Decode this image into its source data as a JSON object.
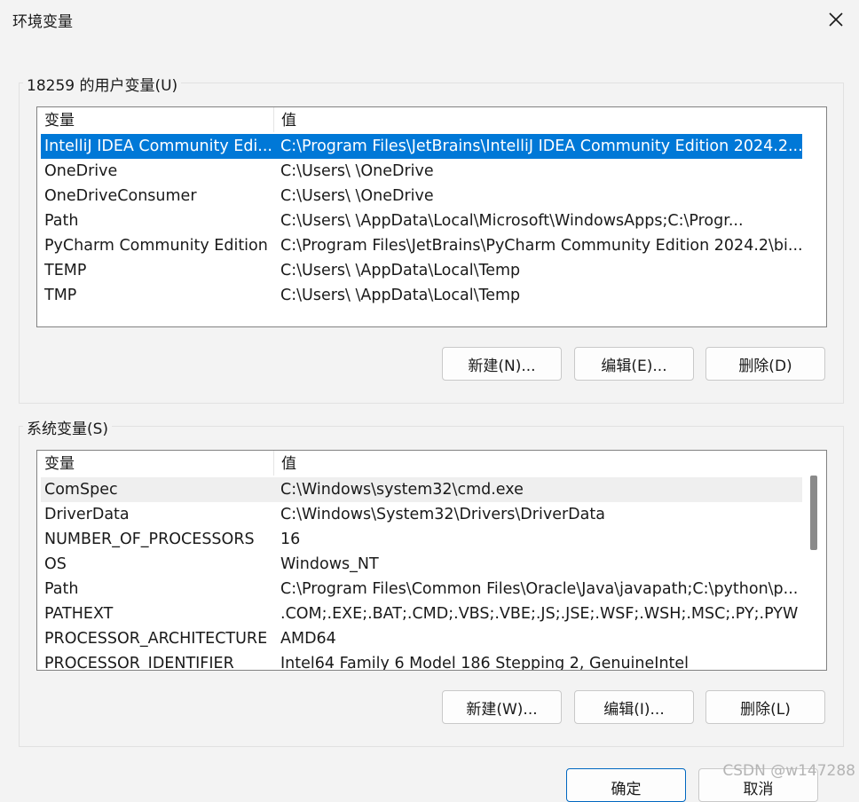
{
  "window": {
    "title": "环境变量",
    "close_icon": "close-icon"
  },
  "user_vars": {
    "group_label": "18259 的用户变量(U)",
    "columns": [
      "变量",
      "值"
    ],
    "rows": [
      {
        "name": "IntelliJ IDEA Community Edi...",
        "value": "C:\\Program Files\\JetBrains\\IntelliJ IDEA Community Edition 2024.2..."
      },
      {
        "name": "OneDrive",
        "value": "C:\\Users\\ \\OneDrive"
      },
      {
        "name": "OneDriveConsumer",
        "value": "C:\\Users\\ \\OneDrive"
      },
      {
        "name": "Path",
        "value": "C:\\Users\\ \\AppData\\Local\\Microsoft\\WindowsApps;C:\\Progr..."
      },
      {
        "name": "PyCharm Community Edition",
        "value": "C:\\Program Files\\JetBrains\\PyCharm Community Edition 2024.2\\bi..."
      },
      {
        "name": "TEMP",
        "value": "C:\\Users\\ \\AppData\\Local\\Temp"
      },
      {
        "name": "TMP",
        "value": "C:\\Users\\ \\AppData\\Local\\Temp"
      }
    ],
    "buttons": {
      "new": "新建(N)...",
      "edit": "编辑(E)...",
      "delete": "删除(D)"
    }
  },
  "system_vars": {
    "group_label": "系统变量(S)",
    "columns": [
      "变量",
      "值"
    ],
    "rows": [
      {
        "name": "ComSpec",
        "value": "C:\\Windows\\system32\\cmd.exe"
      },
      {
        "name": "DriverData",
        "value": "C:\\Windows\\System32\\Drivers\\DriverData"
      },
      {
        "name": "NUMBER_OF_PROCESSORS",
        "value": "16"
      },
      {
        "name": "OS",
        "value": "Windows_NT"
      },
      {
        "name": "Path",
        "value": "C:\\Program Files\\Common Files\\Oracle\\Java\\javapath;C:\\python\\p..."
      },
      {
        "name": "PATHEXT",
        "value": ".COM;.EXE;.BAT;.CMD;.VBS;.VBE;.JS;.JSE;.WSF;.WSH;.MSC;.PY;.PYW"
      },
      {
        "name": "PROCESSOR_ARCHITECTURE",
        "value": "AMD64"
      },
      {
        "name": "PROCESSOR_IDENTIFIER",
        "value": "Intel64 Family 6 Model 186 Stepping 2, GenuineIntel"
      }
    ],
    "buttons": {
      "new": "新建(W)...",
      "edit": "编辑(I)...",
      "delete": "删除(L)"
    }
  },
  "footer": {
    "ok": "确定",
    "cancel": "取消",
    "watermark": "CSDN @w147288"
  },
  "colors": {
    "selection": "#0078d7",
    "background": "#f3f3f3",
    "primary_border": "#0067c0"
  }
}
